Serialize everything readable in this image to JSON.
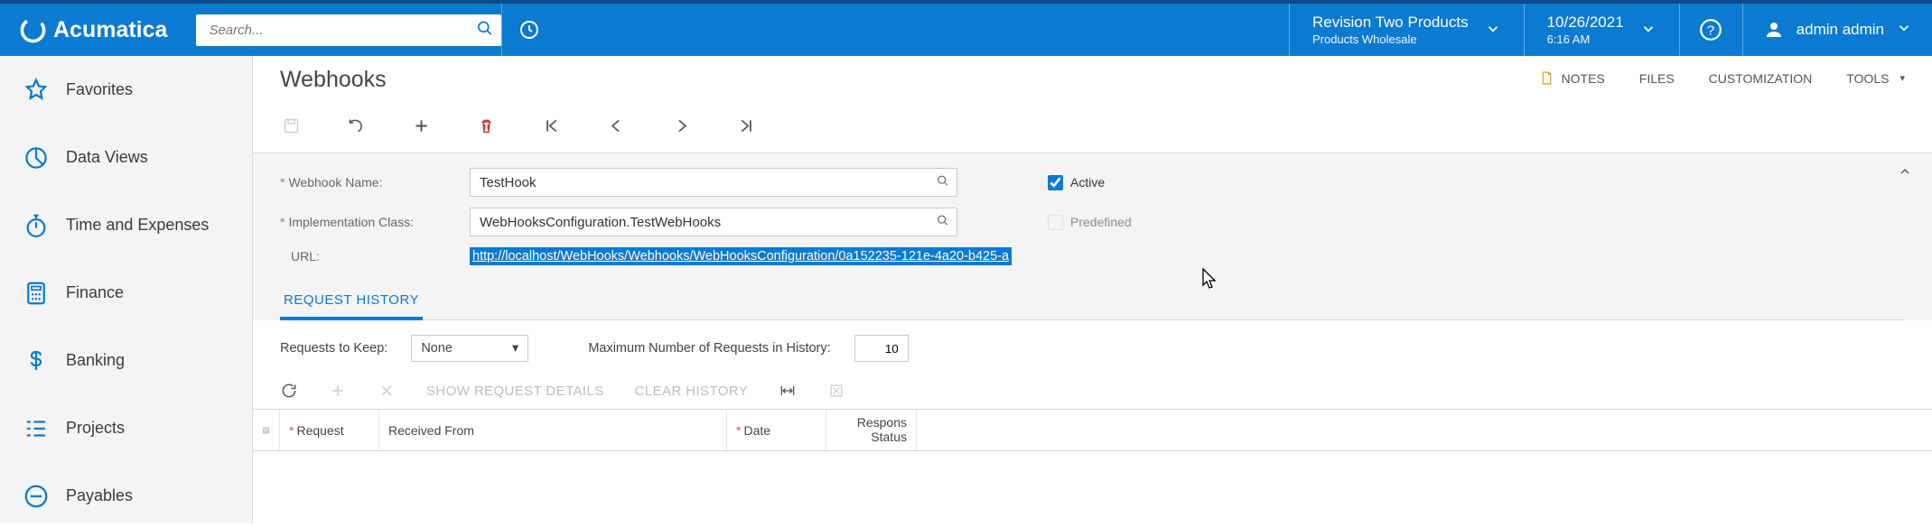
{
  "top": {
    "search_placeholder": "Search...",
    "company": "Revision Two Products",
    "company_sub": "Products Wholesale",
    "date": "10/26/2021",
    "time": "6:16 AM",
    "user": "admin admin"
  },
  "sidebar": {
    "items": [
      {
        "label": "Favorites"
      },
      {
        "label": "Data Views"
      },
      {
        "label": "Time and Expenses"
      },
      {
        "label": "Finance"
      },
      {
        "label": "Banking"
      },
      {
        "label": "Projects"
      },
      {
        "label": "Payables"
      }
    ]
  },
  "page": {
    "title": "Webhooks",
    "links": {
      "notes": "NOTES",
      "files": "FILES",
      "customization": "CUSTOMIZATION",
      "tools": "TOOLS"
    }
  },
  "form": {
    "labels": {
      "name": "Webhook Name:",
      "impl": "Implementation Class:",
      "url": "URL:",
      "active": "Active",
      "predefined": "Predefined"
    },
    "values": {
      "name": "TestHook",
      "impl": "WebHooksConfiguration.TestWebHooks",
      "url": "http://localhost/WebHooks/Webhooks/WebHooksConfiguration/0a152235-121e-4a20-b425-a",
      "active": true,
      "predefined": false
    }
  },
  "tabs": {
    "request_history": "REQUEST HISTORY"
  },
  "history": {
    "keep_label": "Requests to Keep:",
    "keep_value": "None",
    "max_label": "Maximum Number of Requests in History:",
    "max_value": "10",
    "btn_show_details": "SHOW REQUEST DETAILS",
    "btn_clear": "CLEAR HISTORY",
    "columns": {
      "request": "Request",
      "received_from": "Received From",
      "date": "Date",
      "status1": "Respons",
      "status2": "Status"
    }
  }
}
